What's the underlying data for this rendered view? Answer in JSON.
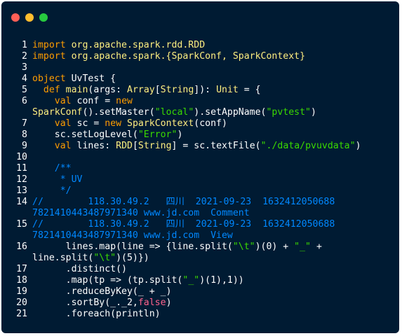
{
  "window": {
    "colors": {
      "background": "#001b33",
      "keyword": "#ff9d00",
      "type": "#ffee80",
      "string": "#3ad900",
      "comment": "#0088ff",
      "boolean": "#ff628c"
    }
  },
  "code": {
    "lines": [
      {
        "n": "1",
        "segs": [
          [
            "kw",
            "import"
          ],
          [
            "ty",
            " org.apache.spark.rdd.RDD"
          ]
        ]
      },
      {
        "n": "2",
        "segs": [
          [
            "kw",
            "import"
          ],
          [
            "ty",
            " org.apache.spark.{SparkConf, SparkContext}"
          ]
        ]
      },
      {
        "n": "3",
        "segs": []
      },
      {
        "n": "4",
        "segs": [
          [
            "kw",
            "object"
          ],
          [
            "plain",
            " UvTest {"
          ]
        ]
      },
      {
        "n": "5",
        "segs": [
          [
            "plain",
            "  "
          ],
          [
            "kw",
            "def"
          ],
          [
            "ty",
            " main"
          ],
          [
            "plain",
            "(args: "
          ],
          [
            "ty",
            "Array"
          ],
          [
            "plain",
            "["
          ],
          [
            "ty",
            "String"
          ],
          [
            "plain",
            "]): "
          ],
          [
            "ty",
            "Unit"
          ],
          [
            "plain",
            " = {"
          ]
        ]
      },
      {
        "n": "6",
        "segs": [
          [
            "plain",
            "    "
          ],
          [
            "kw",
            "val"
          ],
          [
            "plain",
            " conf = "
          ],
          [
            "kw",
            "new"
          ]
        ],
        "cont": [
          [
            "ty",
            "SparkConf"
          ],
          [
            "plain",
            "().setMaster("
          ],
          [
            "str",
            "\"local\""
          ],
          [
            "plain",
            ").setAppName("
          ],
          [
            "str",
            "\"pvtest\""
          ],
          [
            "plain",
            ")"
          ]
        ]
      },
      {
        "n": "7",
        "segs": [
          [
            "plain",
            "    "
          ],
          [
            "kw",
            "val"
          ],
          [
            "plain",
            " sc = "
          ],
          [
            "kw",
            "new"
          ],
          [
            "ty",
            " SparkContext"
          ],
          [
            "plain",
            "(conf)"
          ]
        ]
      },
      {
        "n": "8",
        "segs": [
          [
            "plain",
            "    sc.setLogLevel("
          ],
          [
            "str",
            "\"Error\""
          ],
          [
            "plain",
            ")"
          ]
        ]
      },
      {
        "n": "9",
        "segs": [
          [
            "plain",
            "    "
          ],
          [
            "kw",
            "val"
          ],
          [
            "plain",
            " lines: "
          ],
          [
            "ty",
            "RDD"
          ],
          [
            "plain",
            "["
          ],
          [
            "ty",
            "String"
          ],
          [
            "plain",
            "] = sc.textFile("
          ],
          [
            "str",
            "\"./data/pvuvdata\""
          ],
          [
            "plain",
            ")"
          ]
        ]
      },
      {
        "n": "10",
        "segs": []
      },
      {
        "n": "11",
        "segs": [
          [
            "cm",
            "    /**"
          ]
        ]
      },
      {
        "n": "12",
        "segs": [
          [
            "cm",
            "     * UV"
          ]
        ]
      },
      {
        "n": "13",
        "segs": [
          [
            "cm",
            "     */"
          ]
        ]
      },
      {
        "n": "14",
        "segs": [
          [
            "cm",
            "//        118.30.49.2   四川  2021-09-23  1632412050688"
          ]
        ],
        "cont": [
          [
            "cm",
            "7821410443487971340 www.jd.com  Comment"
          ]
        ]
      },
      {
        "n": "15",
        "segs": [
          [
            "cm",
            "//        118.30.49.2   四川  2021-09-23  1632412050688"
          ]
        ],
        "cont": [
          [
            "cm",
            "7821410443487971340 www.jd.com  View"
          ]
        ]
      },
      {
        "n": "16",
        "segs": [
          [
            "plain",
            "      lines.map(line => {line.split("
          ],
          [
            "str",
            "\"\\t\""
          ],
          [
            "plain",
            ")(0) + "
          ],
          [
            "str",
            "\"_\""
          ],
          [
            "plain",
            " +"
          ]
        ],
        "cont": [
          [
            "plain",
            "line.split("
          ],
          [
            "str",
            "\"\\t\""
          ],
          [
            "plain",
            ")(5)})"
          ]
        ]
      },
      {
        "n": "17",
        "segs": [
          [
            "plain",
            "      .distinct()"
          ]
        ]
      },
      {
        "n": "18",
        "segs": [
          [
            "plain",
            "      .map(tp => (tp.split("
          ],
          [
            "str",
            "\"_\""
          ],
          [
            "plain",
            ")(1),1))"
          ]
        ]
      },
      {
        "n": "19",
        "segs": [
          [
            "plain",
            "      .reduceByKey(_ + _)"
          ]
        ]
      },
      {
        "n": "20",
        "segs": [
          [
            "plain",
            "      .sortBy(_._2,"
          ],
          [
            "bool",
            "false"
          ],
          [
            "plain",
            ")"
          ]
        ]
      },
      {
        "n": "21",
        "segs": [
          [
            "plain",
            "      .foreach(println)"
          ]
        ]
      }
    ]
  }
}
